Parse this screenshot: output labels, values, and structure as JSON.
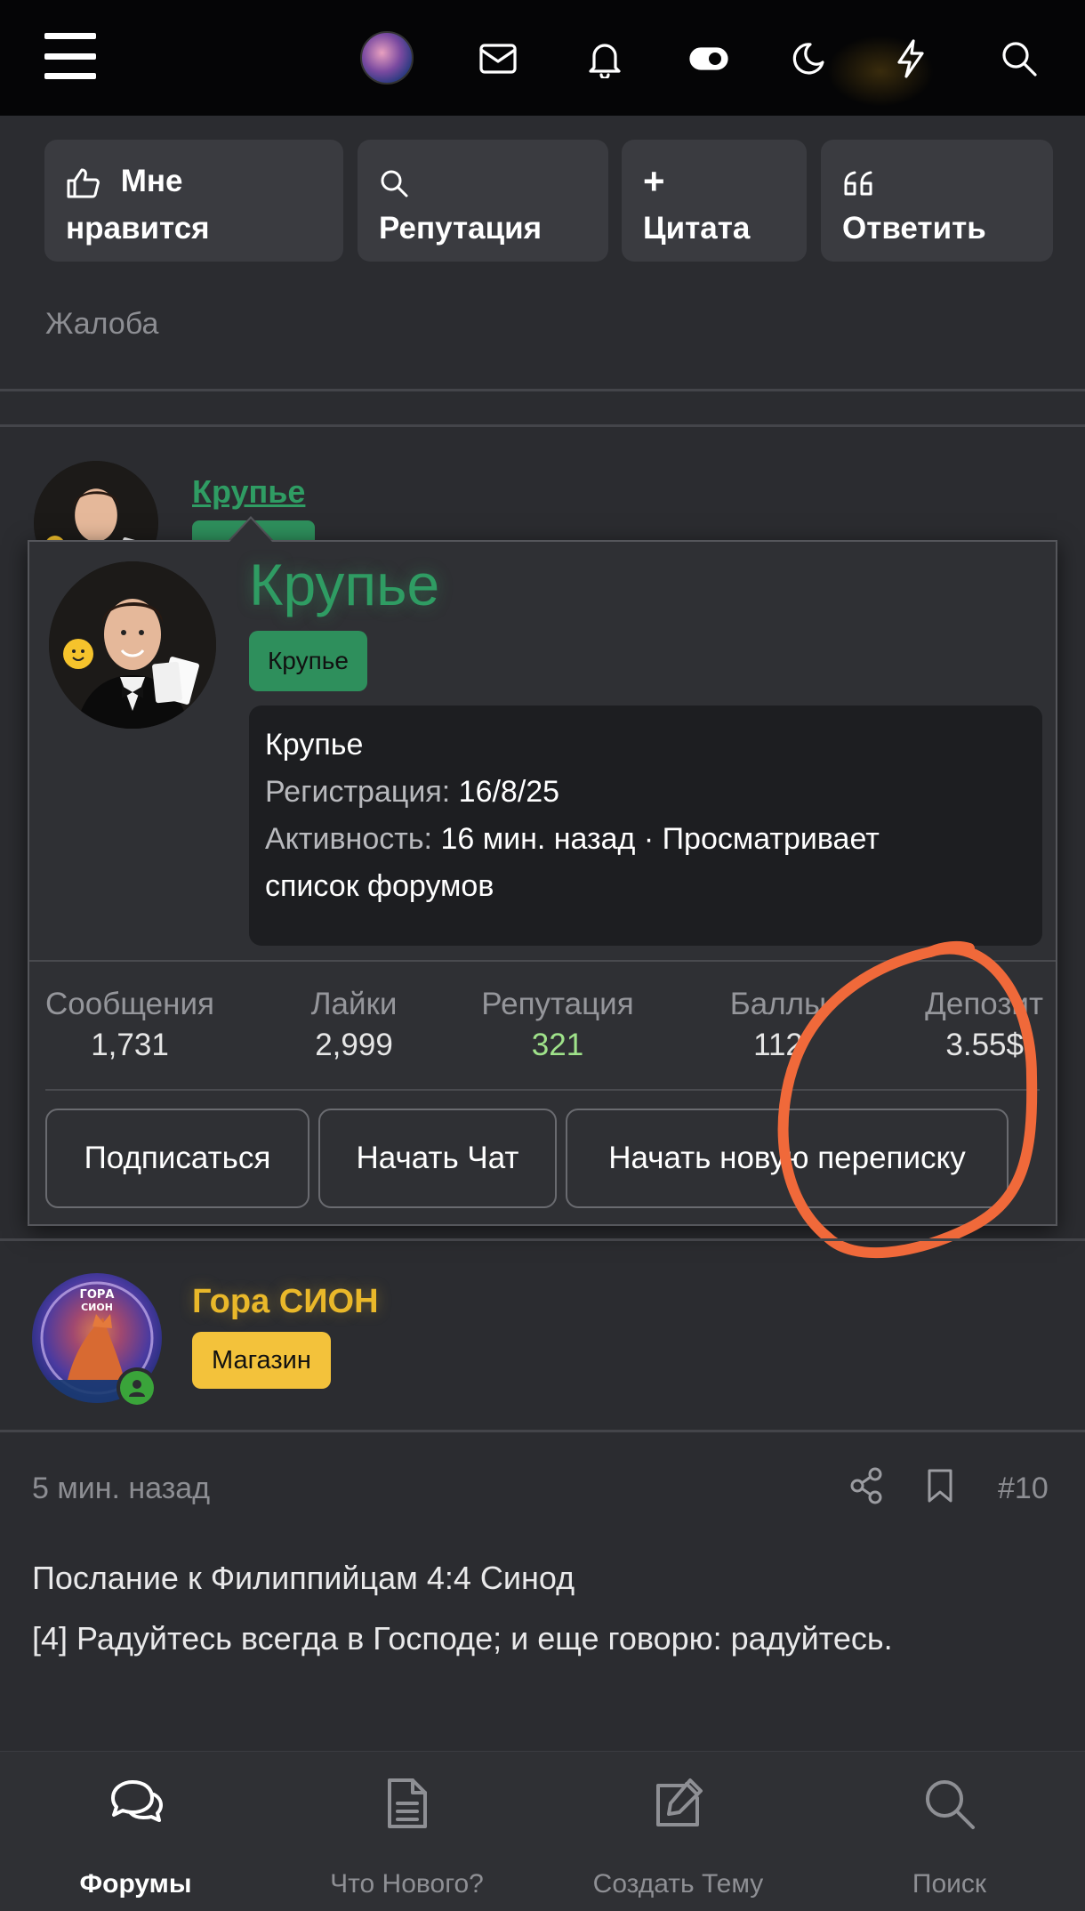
{
  "header": {
    "icons": [
      "menu-icon",
      "avatar",
      "mail-icon",
      "bell-icon",
      "toggle-icon",
      "moon-icon",
      "lightning-icon",
      "search-icon"
    ]
  },
  "post_actions": {
    "like": "Мне нравится",
    "like_line1": "Мне",
    "like_line2": "нравится",
    "reputation": "Репутация",
    "quote_plus": "+",
    "quote": "Цитата",
    "reply": "Ответить",
    "complaint": "Жалоба"
  },
  "author_card": {
    "name": "Крупье",
    "badge": "Крупье",
    "info_title": "Крупье",
    "registration_label": "Регистрация:",
    "registration_value": "16/8/25",
    "activity_label": "Активность:",
    "activity_value": "16 мин. назад · Просматривает",
    "activity_value_cont": "список форумов",
    "stats": [
      {
        "label": "Сообщения",
        "value": "1,731"
      },
      {
        "label": "Лайки",
        "value": "2,999"
      },
      {
        "label": "Репутация",
        "value": "321"
      },
      {
        "label": "Баллы",
        "value": "112"
      },
      {
        "label": "Депозит",
        "value": "3.55$"
      }
    ],
    "buttons": {
      "follow": "Подписаться",
      "chat": "Начать Чат",
      "conversation": "Начать новую переписку"
    },
    "colors": {
      "name": "#2f9c63",
      "reputation_value": "#9fe28a",
      "annotation": "#f0693a"
    }
  },
  "author_small": {
    "name": "Крупье"
  },
  "next_post": {
    "author": "Гора СИОН",
    "badge": "Магазин",
    "time": "5 мин. назад",
    "number": "#10",
    "line1": "Послание к Филиппийцам 4:4 Синод",
    "line2": "[4] Радуйтесь всегда в Господе; и еще говорю: радуйтесь."
  },
  "bottom_nav": [
    {
      "label": "Форумы",
      "icon": "chat-bubbles-icon",
      "active": true
    },
    {
      "label": "Что Нового?",
      "icon": "document-icon",
      "active": false
    },
    {
      "label": "Создать Тему",
      "icon": "edit-icon",
      "active": false
    },
    {
      "label": "Поиск",
      "icon": "search-icon",
      "active": false
    }
  ]
}
